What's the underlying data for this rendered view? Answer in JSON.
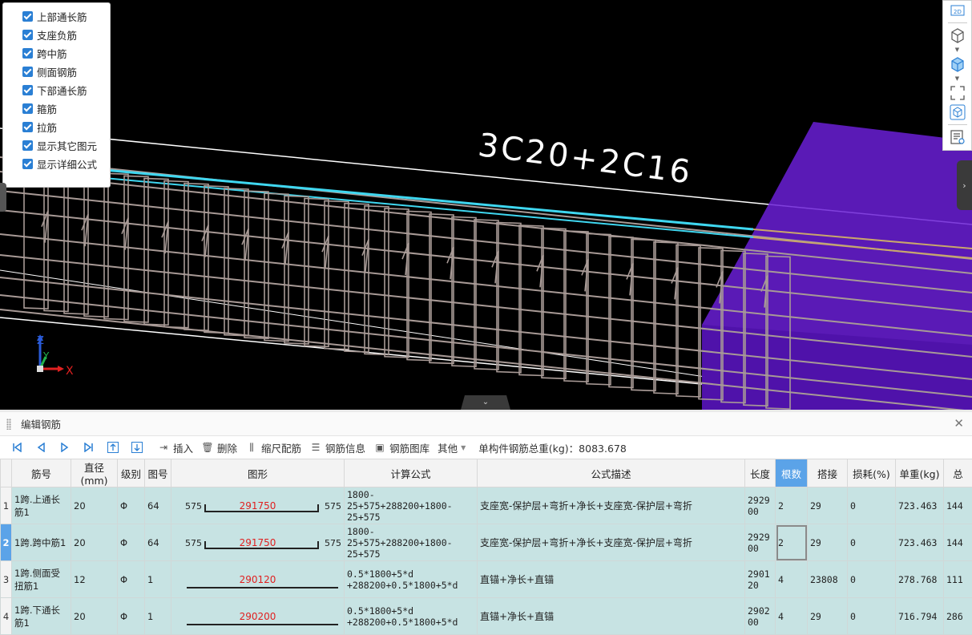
{
  "viewport": {
    "beam_label": "3C20+2C16",
    "layers": [
      {
        "label": "上部通长筋",
        "checked": true
      },
      {
        "label": "支座负筋",
        "checked": true
      },
      {
        "label": "跨中筋",
        "checked": true
      },
      {
        "label": "侧面钢筋",
        "checked": true
      },
      {
        "label": "下部通长筋",
        "checked": true
      },
      {
        "label": "箍筋",
        "checked": true
      },
      {
        "label": "拉筋",
        "checked": true
      },
      {
        "label": "显示其它图元",
        "checked": true
      },
      {
        "label": "显示详细公式",
        "checked": true
      }
    ],
    "view_toolbar": {
      "btn_2d": "2D"
    },
    "axis": {
      "x": "X",
      "y": "Y",
      "z": "Z"
    },
    "colors": {
      "background": "#000000",
      "rebar": "#a89a96",
      "top_bar": "#3fd7f0",
      "column": "#6a1fd6"
    }
  },
  "editor": {
    "title": "编辑钢筋",
    "toolbar": {
      "insert": "插入",
      "delete": "删除",
      "scale": "缩尺配筋",
      "info": "钢筋信息",
      "library": "钢筋图库",
      "other": "其他",
      "total": "单构件钢筋总重(kg)：8083.678"
    },
    "columns": [
      "筋号",
      "直径(mm)",
      "级别",
      "图号",
      "图形",
      "计算公式",
      "公式描述",
      "长度",
      "根数",
      "搭接",
      "损耗(%)",
      "单重(kg)",
      "总"
    ],
    "rows": [
      {
        "no": "1",
        "name": "1跨.上通长筋1",
        "dia": "20",
        "grade": "Φ",
        "fig": "64",
        "shape_left": "575",
        "shape_mid": "291750",
        "shape_right": "575",
        "shape_type": "bent",
        "formula": "1800-25+575+288200+1800-25+575",
        "desc": "支座宽-保护层+弯折+净长+支座宽-保护层+弯折",
        "length": "292900",
        "count": "2",
        "lap": "29",
        "loss": "0",
        "unit_weight": "723.463",
        "total": "144"
      },
      {
        "no": "2",
        "name": "1跨.跨中筋1",
        "dia": "20",
        "grade": "Φ",
        "fig": "64",
        "shape_left": "575",
        "shape_mid": "291750",
        "shape_right": "575",
        "shape_type": "bent",
        "formula": "1800-25+575+288200+1800-25+575",
        "desc": "支座宽-保护层+弯折+净长+支座宽-保护层+弯折",
        "length": "292900",
        "count": "2",
        "lap": "29",
        "loss": "0",
        "unit_weight": "723.463",
        "total": "144"
      },
      {
        "no": "3",
        "name": "1跨.侧面受扭筋1",
        "dia": "12",
        "grade": "Φ",
        "fig": "1",
        "shape_left": "",
        "shape_mid": "290120",
        "shape_right": "",
        "shape_type": "straight",
        "formula": "0.5*1800+5*d +288200+0.5*1800+5*d",
        "desc": "直锚+净长+直锚",
        "length": "290120",
        "count": "4",
        "lap": "23808",
        "loss": "0",
        "unit_weight": "278.768",
        "total": "111"
      },
      {
        "no": "4",
        "name": "1跨.下通长筋1",
        "dia": "20",
        "grade": "Φ",
        "fig": "1",
        "shape_left": "",
        "shape_mid": "290200",
        "shape_right": "",
        "shape_type": "straight",
        "formula": "0.5*1800+5*d +288200+0.5*1800+5*d",
        "desc": "直锚+净长+直锚",
        "length": "290200",
        "count": "4",
        "lap": "29",
        "loss": "0",
        "unit_weight": "716.794",
        "total": "286"
      }
    ]
  }
}
